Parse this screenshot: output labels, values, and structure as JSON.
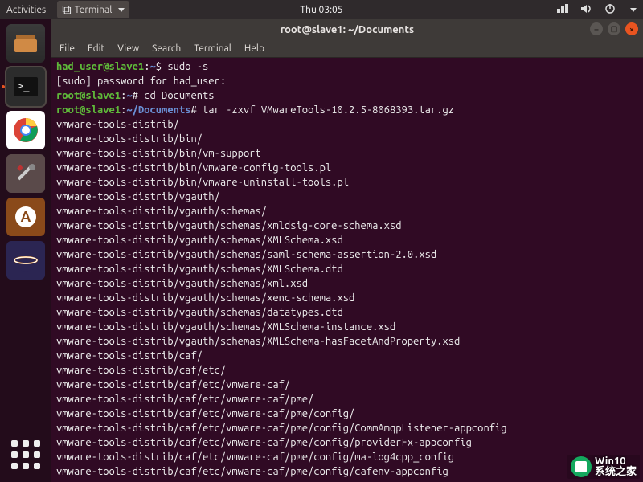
{
  "topbar": {
    "activities": "Activities",
    "app_label": "Terminal",
    "clock": "Thu 03:05"
  },
  "window": {
    "title": "root@slave1: ~/Documents"
  },
  "menubar": {
    "file": "File",
    "edit": "Edit",
    "view": "View",
    "search": "Search",
    "terminal": "Terminal",
    "help": "Help"
  },
  "prompt1": {
    "userhost": "had_user@slave1",
    "colon": ":",
    "path": "~",
    "sym": "$ ",
    "cmd": "sudo -s"
  },
  "line2": "[sudo] password for had_user:",
  "prompt3": {
    "userhost": "root@slave1",
    "colon": ":",
    "path": "~",
    "sym": "# ",
    "cmd": "cd Documents"
  },
  "prompt4": {
    "userhost": "root@slave1",
    "colon": ":",
    "path": "~/Documents",
    "sym": "# ",
    "cmd": "tar -zxvf VMwareTools-10.2.5-8068393.tar.gz"
  },
  "output": [
    "vmware-tools-distrib/",
    "vmware-tools-distrib/bin/",
    "vmware-tools-distrib/bin/vm-support",
    "vmware-tools-distrib/bin/vmware-config-tools.pl",
    "vmware-tools-distrib/bin/vmware-uninstall-tools.pl",
    "vmware-tools-distrib/vgauth/",
    "vmware-tools-distrib/vgauth/schemas/",
    "vmware-tools-distrib/vgauth/schemas/xmldsig-core-schema.xsd",
    "vmware-tools-distrib/vgauth/schemas/XMLSchema.xsd",
    "vmware-tools-distrib/vgauth/schemas/saml-schema-assertion-2.0.xsd",
    "vmware-tools-distrib/vgauth/schemas/XMLSchema.dtd",
    "vmware-tools-distrib/vgauth/schemas/xml.xsd",
    "vmware-tools-distrib/vgauth/schemas/xenc-schema.xsd",
    "vmware-tools-distrib/vgauth/schemas/datatypes.dtd",
    "vmware-tools-distrib/vgauth/schemas/XMLSchema-instance.xsd",
    "vmware-tools-distrib/vgauth/schemas/XMLSchema-hasFacetAndProperty.xsd",
    "vmware-tools-distrib/caf/",
    "vmware-tools-distrib/caf/etc/",
    "vmware-tools-distrib/caf/etc/vmware-caf/",
    "vmware-tools-distrib/caf/etc/vmware-caf/pme/",
    "vmware-tools-distrib/caf/etc/vmware-caf/pme/config/",
    "vmware-tools-distrib/caf/etc/vmware-caf/pme/config/CommAmqpListener-appconfig",
    "vmware-tools-distrib/caf/etc/vmware-caf/pme/config/providerFx-appconfig",
    "vmware-tools-distrib/caf/etc/vmware-caf/pme/config/ma-log4cpp_config",
    "vmware-tools-distrib/caf/etc/vmware-caf/pme/config/cafenv-appconfig"
  ],
  "watermark": {
    "line1": "Win10",
    "line2": "系统之家"
  }
}
